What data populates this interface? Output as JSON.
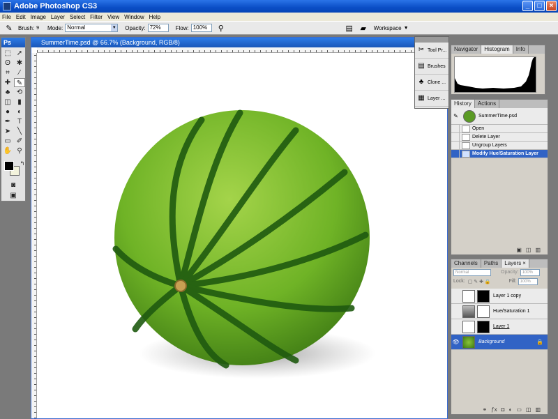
{
  "window": {
    "title": "Adobe Photoshop CS3",
    "buttons": [
      "_",
      "□",
      "×"
    ]
  },
  "menu": [
    "File",
    "Edit",
    "Image",
    "Layer",
    "Select",
    "Filter",
    "View",
    "Window",
    "Help"
  ],
  "options": {
    "brush_label": "Brush:",
    "brush_size": "9",
    "mode_label": "Mode:",
    "mode_value": "Normal",
    "opacity_label": "Opacity:",
    "opacity_value": "72%",
    "flow_label": "Flow:",
    "flow_value": "100%",
    "workspace_label": "Workspace"
  },
  "toolbox": {
    "header": "Ps"
  },
  "document": {
    "title": "SummerTime.psd @ 66.7% (Background, RGB/8)"
  },
  "mini_palette": {
    "items": [
      "Tool Pr...",
      "Brushes",
      "Clone ...",
      "Layer ..."
    ]
  },
  "top_panel": {
    "tabs": [
      "Navigator",
      "Histogram",
      "Info"
    ],
    "active_tab": "Histogram"
  },
  "history_panel": {
    "tabs": [
      "History",
      "Actions"
    ],
    "snapshot": "SummerTime.psd",
    "states": [
      "Open",
      "Delete Layer",
      "Ungroup Layers",
      "Modify Hue/Saturation Layer"
    ],
    "selected_state": "Modify Hue/Saturation Layer"
  },
  "layers_panel": {
    "tabs": [
      "Channels",
      "Paths",
      "Layers"
    ],
    "blend_mode": "Normal",
    "opacity_label": "Opacity:",
    "opacity_value": "100%",
    "lock_label": "Lock:",
    "fill_label": "Fill:",
    "fill_value": "100%",
    "layers": [
      "Layer 1 copy",
      "Hue/Saturation 1",
      "Layer 1",
      "Background"
    ],
    "selected_layer": "Background"
  },
  "colors": {
    "accent": "#3163c5",
    "title_bar": "#0a4ec6",
    "foreground": "#000000",
    "background": "#f3f3dc"
  }
}
